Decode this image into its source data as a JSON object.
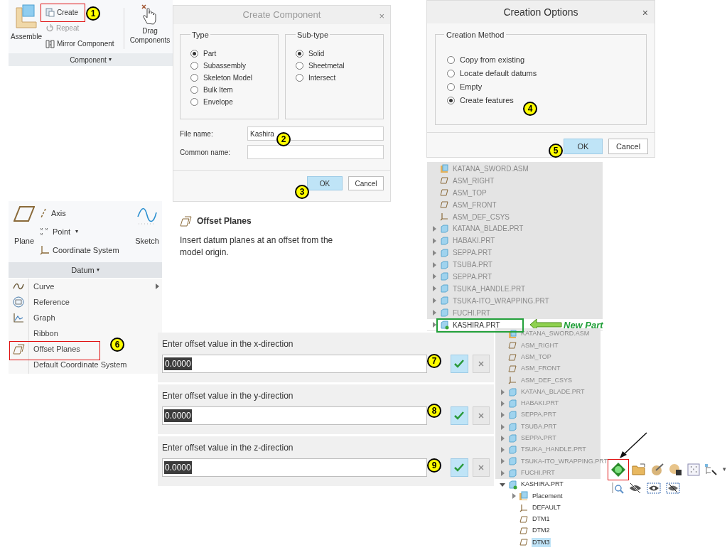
{
  "component_ribbon": {
    "assemble": "Assemble",
    "create": "Create",
    "repeat": "Repeat",
    "mirror": "Mirror Component",
    "drag": "Drag Components",
    "group_label": "Component",
    "group_caret": "▾"
  },
  "create_component": {
    "title": "Create Component",
    "close": "×",
    "type_label": "Type",
    "types": [
      {
        "label": "Part",
        "selected": true
      },
      {
        "label": "Subassembly",
        "selected": false
      },
      {
        "label": "Skeleton Model",
        "selected": false
      },
      {
        "label": "Bulk Item",
        "selected": false
      },
      {
        "label": "Envelope",
        "selected": false
      }
    ],
    "subtype_label": "Sub-type",
    "subtypes": [
      {
        "label": "Solid",
        "selected": true
      },
      {
        "label": "Sheetmetal",
        "selected": false
      },
      {
        "label": "Intersect",
        "selected": false
      }
    ],
    "file_name_label": "File name:",
    "file_name": "Kashira",
    "common_name_label": "Common name:",
    "ok": "OK",
    "cancel": "Cancel"
  },
  "creation_options": {
    "title": "Creation Options",
    "close": "×",
    "group_label": "Creation Method",
    "methods": [
      {
        "label": "Copy from existing",
        "selected": false
      },
      {
        "label": "Locate default datums",
        "selected": false
      },
      {
        "label": "Empty",
        "selected": false
      },
      {
        "label": "Create features",
        "selected": true
      }
    ],
    "ok": "OK",
    "cancel": "Cancel"
  },
  "datum_ribbon": {
    "plane": "Plane",
    "axis": "Axis",
    "point": "Point",
    "coordinate_system": "Coordinate System",
    "sketch": "Sketch",
    "group_label": "Datum",
    "group_caret": "▾"
  },
  "datum_menu": [
    {
      "label": "Curve",
      "kind": "curve",
      "has_submenu": true
    },
    {
      "label": "Reference",
      "kind": "reference",
      "has_submenu": false
    },
    {
      "label": "Graph",
      "kind": "graph",
      "has_submenu": false
    },
    {
      "label": "Ribbon",
      "kind": "none",
      "has_submenu": false
    },
    {
      "label": "Offset Planes",
      "kind": "offset",
      "has_submenu": false
    },
    {
      "label": "Default Coordinate System",
      "kind": "none",
      "has_submenu": false
    }
  ],
  "tooltip": {
    "title": "Offset Planes",
    "text": "Insert datum planes at an offset from the model origin."
  },
  "model_tree_1": [
    {
      "label": "KATANA_SWORD.ASM",
      "kind": "assembly",
      "inactive": true,
      "selected": false
    },
    {
      "label": "ASM_RIGHT",
      "kind": "plane",
      "inactive": true,
      "selected": false
    },
    {
      "label": "ASM_TOP",
      "kind": "plane",
      "inactive": true,
      "selected": false
    },
    {
      "label": "ASM_FRONT",
      "kind": "plane",
      "inactive": true,
      "selected": false
    },
    {
      "label": "ASM_DEF_CSYS",
      "kind": "csys",
      "inactive": true,
      "selected": false
    },
    {
      "label": "KATANA_BLADE.PRT",
      "kind": "part",
      "inactive": true,
      "expanded": false,
      "selected": false
    },
    {
      "label": "HABAKI.PRT",
      "kind": "part",
      "inactive": true,
      "expanded": false,
      "selected": false
    },
    {
      "label": "SEPPA.PRT",
      "kind": "part",
      "inactive": true,
      "expanded": false,
      "selected": false
    },
    {
      "label": "TSUBA.PRT",
      "kind": "part",
      "inactive": true,
      "expanded": false,
      "selected": false
    },
    {
      "label": "SEPPA.PRT",
      "kind": "part",
      "inactive": true,
      "expanded": false,
      "selected": false
    },
    {
      "label": "TSUKA_HANDLE.PRT",
      "kind": "part",
      "inactive": true,
      "expanded": false,
      "selected": false
    },
    {
      "label": "TSUKA-ITO_WRAPPING.PRT",
      "kind": "part",
      "inactive": true,
      "expanded": false,
      "selected": false
    },
    {
      "label": "FUCHI.PRT",
      "kind": "part",
      "inactive": true,
      "expanded": false,
      "selected": false
    },
    {
      "label": "KASHIRA.PRT",
      "kind": "new_part",
      "inactive": false,
      "expanded": false,
      "selected": false
    }
  ],
  "new_part_label": "New Part",
  "offset_prompts": [
    {
      "prompt": "Enter offset value in the x-direction",
      "value": "0.0000"
    },
    {
      "prompt": "Enter offset value in the y-direction",
      "value": "0.0000"
    },
    {
      "prompt": "Enter offset value in the z-direction",
      "value": "0.0000"
    }
  ],
  "model_tree_2": [
    {
      "label": "KATANA_SWORD.ASM",
      "kind": "assembly",
      "inactive": true,
      "selected": false
    },
    {
      "label": "ASM_RIGHT",
      "kind": "plane",
      "inactive": true,
      "selected": false
    },
    {
      "label": "ASM_TOP",
      "kind": "plane",
      "inactive": true,
      "selected": false
    },
    {
      "label": "ASM_FRONT",
      "kind": "plane",
      "inactive": true,
      "selected": false
    },
    {
      "label": "ASM_DEF_CSYS",
      "kind": "csys",
      "inactive": true,
      "selected": false
    },
    {
      "label": "KATANA_BLADE.PRT",
      "kind": "part",
      "inactive": true,
      "expanded": false,
      "selected": false
    },
    {
      "label": "HABAKI.PRT",
      "kind": "part",
      "inactive": true,
      "expanded": false,
      "selected": false
    },
    {
      "label": "SEPPA.PRT",
      "kind": "part",
      "inactive": true,
      "expanded": false,
      "selected": false
    },
    {
      "label": "TSUBA.PRT",
      "kind": "part",
      "inactive": true,
      "expanded": false,
      "selected": false
    },
    {
      "label": "SEPPA.PRT",
      "kind": "part",
      "inactive": true,
      "expanded": false,
      "selected": false
    },
    {
      "label": "TSUKA_HANDLE.PRT",
      "kind": "part",
      "inactive": true,
      "expanded": false,
      "selected": false
    },
    {
      "label": "TSUKA-ITO_WRAPPING.PRT",
      "kind": "part",
      "inactive": true,
      "expanded": false,
      "selected": false
    },
    {
      "label": "FUCHI.PRT",
      "kind": "part",
      "inactive": true,
      "expanded": false,
      "selected": false
    },
    {
      "label": "KASHIRA.PRT",
      "kind": "new_part",
      "inactive": false,
      "expanded": true,
      "selected": false,
      "children": [
        {
          "label": "Placement",
          "kind": "placement",
          "inactive": false,
          "expanded": false,
          "selected": false
        },
        {
          "label": "DEFAULT",
          "kind": "csys",
          "inactive": false,
          "selected": false
        },
        {
          "label": "DTM1",
          "kind": "plane",
          "inactive": false,
          "selected": false
        },
        {
          "label": "DTM2",
          "kind": "plane",
          "inactive": false,
          "selected": false
        },
        {
          "label": "DTM3",
          "kind": "plane",
          "inactive": false,
          "selected": true
        }
      ]
    }
  ],
  "toolbar_caret": "▾",
  "step_markers": [
    "1",
    "2",
    "3",
    "4",
    "5",
    "6",
    "7",
    "8",
    "9"
  ]
}
